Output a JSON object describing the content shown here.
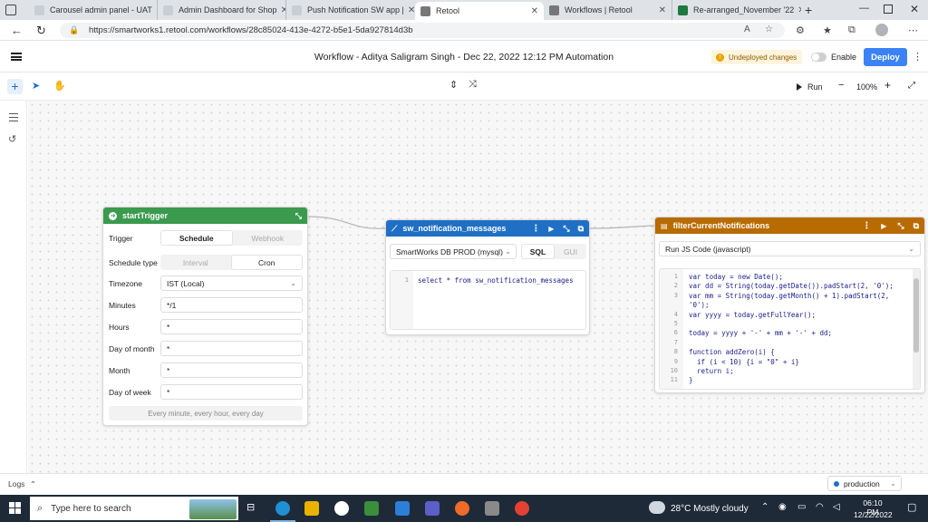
{
  "browser": {
    "tabs": [
      {
        "title": "Carousel admin panel - UAT"
      },
      {
        "title": "Admin Dashboard for Shop"
      },
      {
        "title": "Push Notification SW app |"
      },
      {
        "title": "Retool"
      },
      {
        "title": "Workflows | Retool"
      },
      {
        "title": "Re-arranged_November '22"
      }
    ],
    "url": "https://smartworks1.retool.com/workflows/28c85024-413e-4272-b5e1-5da927814d3b"
  },
  "header": {
    "title": "Workflow - Aditya Saligram Singh - Dec 22, 2022 12:12 PM Automation",
    "undeployed": "Undeployed changes",
    "enable_label": "Enable",
    "deploy_label": "Deploy"
  },
  "toolbar": {
    "run_label": "Run",
    "zoom": "100%"
  },
  "start_trigger": {
    "title": "startTrigger",
    "trigger_label": "Trigger",
    "trigger_options": [
      "Schedule",
      "Webhook"
    ],
    "schedule_type_label": "Schedule type",
    "schedule_type_options": [
      "Interval",
      "Cron"
    ],
    "timezone_label": "Timezone",
    "timezone_value": "IST (Local)",
    "minutes_label": "Minutes",
    "minutes_value": "*/1",
    "hours_label": "Hours",
    "hours_value": "*",
    "dom_label": "Day of month",
    "dom_value": "*",
    "month_label": "Month",
    "month_value": "*",
    "dow_label": "Day of week",
    "dow_value": "*",
    "summary": "Every minute, every hour, every day"
  },
  "sql_block": {
    "title": "sw_notification_messages",
    "resource": "SmartWorks DB PROD (mysql)",
    "modes": [
      "SQL",
      "GUI"
    ],
    "line": "1",
    "query": "select * from sw_notification_messages"
  },
  "js_block": {
    "title": "filterCurrentNotifications",
    "resource": "Run JS Code (javascript)",
    "line_numbers": [
      "1",
      "2",
      "3",
      "",
      "4",
      "5",
      "6",
      "7",
      "8",
      "9",
      "10",
      "11"
    ],
    "code_lines": [
      "var today = new Date();",
      "var dd = String(today.getDate()).padStart(2, '0');",
      "var mm = String(today.getMonth() + 1).padStart(2,",
      "'0');",
      "var yyyy = today.getFullYear();",
      "",
      "today = yyyy + '-' + mm + '-' + dd;",
      "",
      "function addZero(i) {",
      "  if (i < 10) {i = \"0\" + i}",
      "  return i;",
      "}"
    ]
  },
  "footer": {
    "logs_label": "Logs",
    "environment": "production"
  },
  "taskbar": {
    "search_placeholder": "Type here to search",
    "weather": "28°C  Mostly cloudy",
    "time": "06:10 PM",
    "date": "12/22/2022"
  },
  "colors": {
    "trigger_green": "#3a9a4d",
    "sql_blue": "#1f6fc5",
    "js_orange": "#b86b00",
    "deploy_blue": "#3b82f6"
  }
}
